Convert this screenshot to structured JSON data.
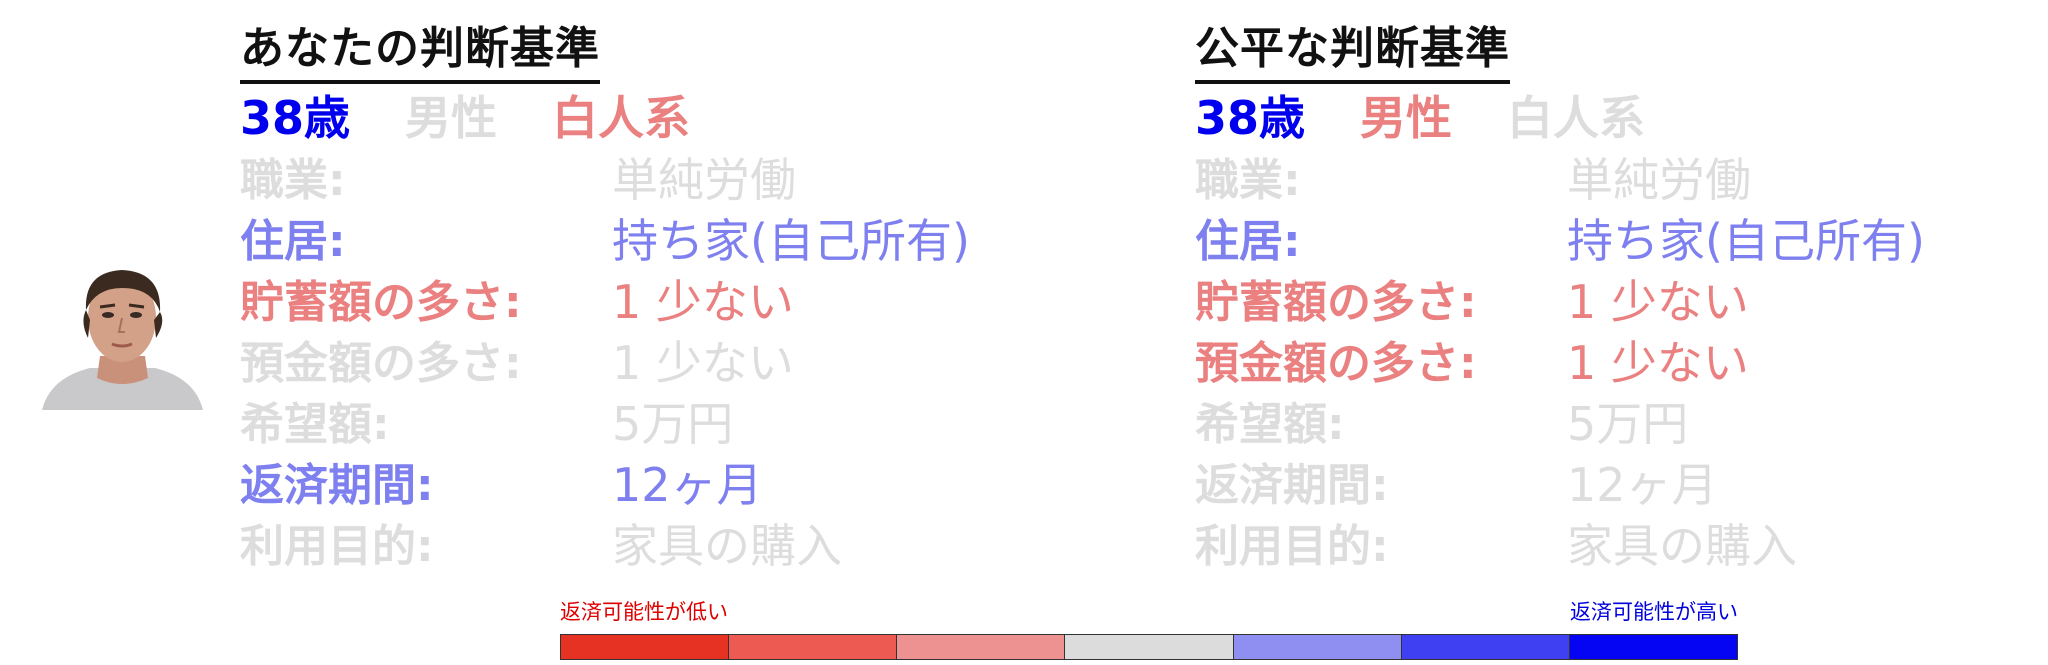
{
  "colors": {
    "title": "#111111",
    "blue_strong": "#0000ee",
    "blue_soft": "#7f80f0",
    "red_soft": "#ea8080",
    "gray": "#dddddd",
    "legend_low_text": "#dd0000",
    "legend_high_text": "#0000dd"
  },
  "legend": {
    "low_label": "返済可能性が低い",
    "high_label": "返済可能性が高い",
    "segments": [
      "#e53222",
      "#ec5a52",
      "#ee9291",
      "#dcdcdc",
      "#8f8ff2",
      "#4040f3",
      "#0505f4"
    ]
  },
  "panels": [
    {
      "title": "あなたの判断基準",
      "demographics": [
        {
          "text": "38歳",
          "color": "#0000ee"
        },
        {
          "text": "男性",
          "color": "#dddddd"
        },
        {
          "text": "白人系",
          "color": "#ea8080"
        }
      ],
      "rows": [
        {
          "label": "職業:",
          "value": "単純労働",
          "color": "#dddddd"
        },
        {
          "label": "住居:",
          "value": "持ち家(自己所有)",
          "color": "#7f80f0"
        },
        {
          "label": "貯蓄額の多さ:",
          "value": "1 少ない",
          "color": "#ea8080"
        },
        {
          "label": "預金額の多さ:",
          "value": "1 少ない",
          "color": "#dddddd"
        },
        {
          "label": "希望額:",
          "value": "5万円",
          "color": "#dddddd"
        },
        {
          "label": "返済期間:",
          "value": "12ヶ月",
          "color": "#7f80f0"
        },
        {
          "label": "利用目的:",
          "value": "家具の購入",
          "color": "#dddddd"
        }
      ]
    },
    {
      "title": "公平な判断基準",
      "demographics": [
        {
          "text": "38歳",
          "color": "#0000ee"
        },
        {
          "text": "男性",
          "color": "#ea8080"
        },
        {
          "text": "白人系",
          "color": "#dddddd"
        }
      ],
      "rows": [
        {
          "label": "職業:",
          "value": "単純労働",
          "color": "#dddddd"
        },
        {
          "label": "住居:",
          "value": "持ち家(自己所有)",
          "color": "#7f80f0"
        },
        {
          "label": "貯蓄額の多さ:",
          "value": "1 少ない",
          "color": "#ea8080"
        },
        {
          "label": "預金額の多さ:",
          "value": "1 少ない",
          "color": "#ea8080"
        },
        {
          "label": "希望額:",
          "value": "5万円",
          "color": "#dddddd"
        },
        {
          "label": "返済期間:",
          "value": "12ヶ月",
          "color": "#dddddd"
        },
        {
          "label": "利用目的:",
          "value": "家具の購入",
          "color": "#dddddd"
        }
      ]
    }
  ]
}
